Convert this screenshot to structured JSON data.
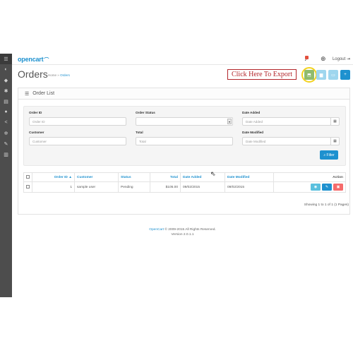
{
  "sidebar": {
    "items": [
      {
        "icon": "menu-icon",
        "glyph": "☰"
      },
      {
        "icon": "dashboard-icon",
        "glyph": "◐"
      },
      {
        "icon": "tag-icon",
        "glyph": "◆"
      },
      {
        "icon": "puzzle-icon",
        "glyph": "✱"
      },
      {
        "icon": "cart-icon",
        "glyph": "▤"
      },
      {
        "icon": "user-icon",
        "glyph": "●"
      },
      {
        "icon": "share-icon",
        "glyph": "<"
      },
      {
        "icon": "gear-icon",
        "glyph": "✲"
      },
      {
        "icon": "wrench-icon",
        "glyph": "✎"
      },
      {
        "icon": "chart-icon",
        "glyph": "▥"
      }
    ]
  },
  "header": {
    "logo": "opencart",
    "logout": "Logout"
  },
  "page": {
    "title": "Orders",
    "breadcrumb": {
      "home": "Home",
      "sep": "»",
      "current": "Orders"
    },
    "export_label": "Click Here To Export"
  },
  "panel": {
    "title": "Order List"
  },
  "filters": {
    "order_id": {
      "label": "Order ID",
      "placeholder": "Order ID"
    },
    "order_status": {
      "label": "Order Status",
      "value": ""
    },
    "date_added": {
      "label": "Date Added",
      "placeholder": "Date Added"
    },
    "customer": {
      "label": "Customer",
      "placeholder": "Customer"
    },
    "total": {
      "label": "Total",
      "placeholder": "Total"
    },
    "date_modified": {
      "label": "Date Modified",
      "placeholder": "Date Modified"
    },
    "button": "Filter"
  },
  "table": {
    "headers": {
      "order_id": "Order ID",
      "sort_indicator": "▲",
      "customer": "Customer",
      "status": "Status",
      "total": "Total",
      "date_added": "Date Added",
      "date_modified": "Date Modified",
      "action": "Action"
    },
    "rows": [
      {
        "order_id": "1",
        "customer": "sample user",
        "status": "Pending",
        "total": "$105.00",
        "date_added": "09/02/2015",
        "date_modified": "09/02/2015"
      }
    ]
  },
  "pagination": {
    "text": "Showing 1 to 1 of 1 (1 Pages)"
  },
  "footer": {
    "link": "OpenCart",
    "copyright": " © 2009-2015 All Rights Reserved.",
    "version": "Version 2.0.1.1"
  },
  "colors": {
    "primary": "#1e91cf",
    "info": "#5bc0de",
    "danger": "#f56b6b",
    "success": "#8fbb6c",
    "export_highlight": "#f2d21d",
    "export_text": "#b3262b"
  }
}
